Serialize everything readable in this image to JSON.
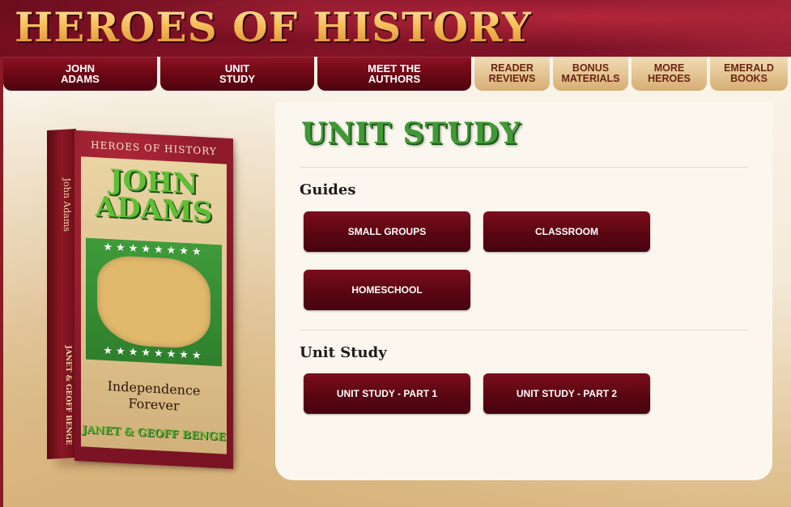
{
  "header": {
    "site_title": "HEROES OF HISTORY"
  },
  "nav": {
    "tabs": [
      {
        "label": "JOHN\nADAMS"
      },
      {
        "label": "UNIT\nSTUDY"
      },
      {
        "label": "MEET THE\nAUTHORS"
      },
      {
        "label": "READER\nREVIEWS"
      },
      {
        "label": "BONUS\nMATERIALS"
      },
      {
        "label": "MORE\nHEROES"
      },
      {
        "label": "EMERALD\nBOOKS"
      }
    ]
  },
  "book": {
    "series": "HEROES OF HISTORY",
    "name": "JOHN\nADAMS",
    "subtitle": "Independence\nForever",
    "authors": "JANET & GEOFF BENGE",
    "spine_title": "John Adams",
    "spine_authors": "JANET & GEOFF BENGE"
  },
  "main": {
    "title": "UNIT STUDY",
    "guides": {
      "heading": "Guides",
      "buttons": [
        "SMALL GROUPS",
        "CLASSROOM",
        "HOMESCHOOL"
      ]
    },
    "unit_study": {
      "heading": "Unit Study",
      "buttons": [
        "UNIT STUDY - PART 1",
        "UNIT STUDY - PART 2"
      ]
    }
  },
  "colors": {
    "brand_red": "#6a0714",
    "gold_tab": "#e2c18e",
    "title_green": "#3f9a35",
    "panel_bg": "#fcf7ee"
  }
}
